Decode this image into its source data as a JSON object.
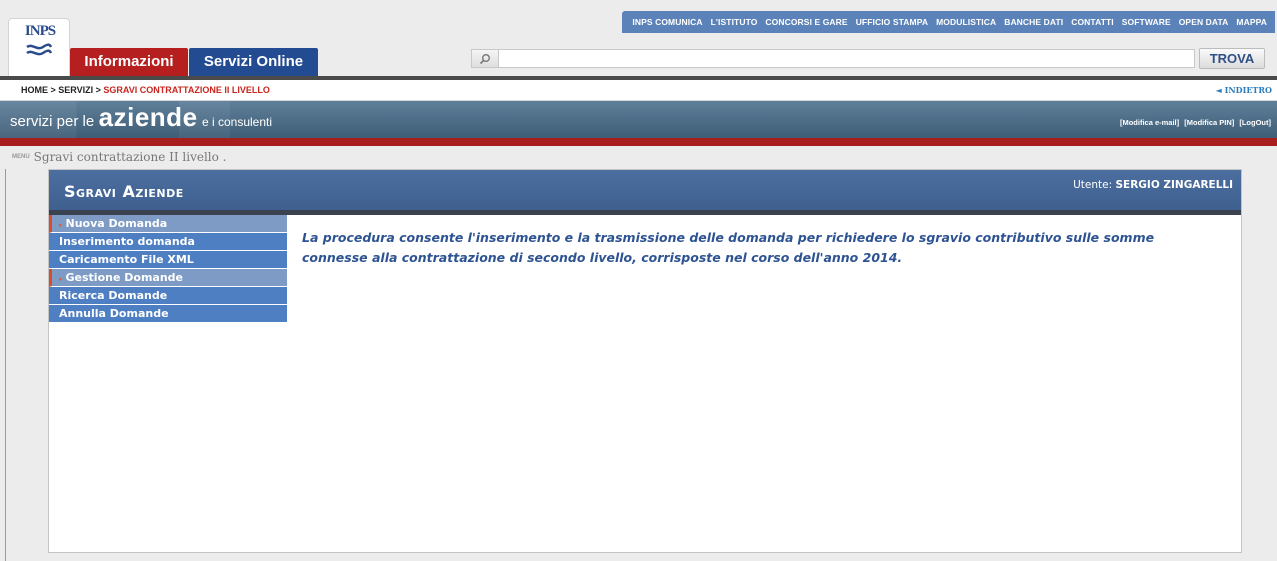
{
  "header": {
    "logo_text": "INPS",
    "top_nav": [
      "INPS COMUNICA",
      "L'ISTITUTO",
      "CONCORSI E GARE",
      "UFFICIO STAMPA",
      "MODULISTICA",
      "BANCHE DATI",
      "CONTATTI",
      "SOFTWARE",
      "OPEN DATA",
      "MAPPA"
    ],
    "tabs": {
      "informazioni": "Informazioni",
      "servizi_online": "Servizi Online"
    },
    "search": {
      "placeholder": "",
      "button_label": "TROVA",
      "icon": "search-icon"
    }
  },
  "breadcrumb": {
    "home": "HOME",
    "sep": " > ",
    "servizi": "SERVIZI",
    "current": "SGRAVI CONTRATTAZIONE II LIVELLO",
    "back": "◄ INDIETRO"
  },
  "banner": {
    "line_small": "servizi per le",
    "line_big": "aziende",
    "line_tail": "e i consulenti",
    "links": [
      "[Modifica e-mail]",
      "[Modifica PIN]",
      "[LogOut]"
    ]
  },
  "menu_bar": {
    "tag": "MENU",
    "text": "Sgravi contrattazione II livello ."
  },
  "panel": {
    "title": "Sgravi Aziende",
    "user_label": "Utente: ",
    "user_name": "SERGIO ZINGARELLI",
    "side_menu": [
      {
        "label": "Nuova Domanda",
        "kind": "head"
      },
      {
        "label": "Inserimento domanda",
        "kind": "link"
      },
      {
        "label": "Caricamento File XML",
        "kind": "link"
      },
      {
        "label": "Gestione Domande",
        "kind": "head"
      },
      {
        "label": "Ricerca Domande",
        "kind": "link"
      },
      {
        "label": "Annulla Domande",
        "kind": "link"
      }
    ],
    "intro_text": "La procedura consente l'inserimento e la trasmissione delle domanda per richiedere lo sgravio contributivo sulle somme connesse alla contrattazione di secondo livello, corrisposte nel corso dell'anno 2014."
  },
  "colors": {
    "tab_red": "#b51f1f",
    "tab_blue": "#234b92",
    "panel_blue": "#4c6fa0",
    "menu_link": "#4f7fc3",
    "menu_head": "#7d9bc4",
    "accent_orange": "#d94b2b",
    "text_blue": "#2d5392"
  }
}
